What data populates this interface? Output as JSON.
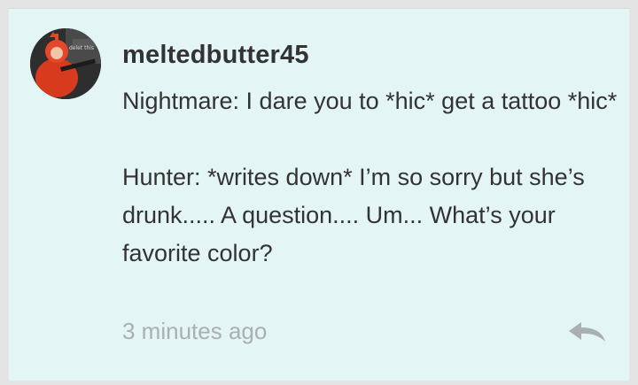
{
  "comment": {
    "username": "meltedbutter45",
    "avatar_caption": "delet this",
    "message_lines": [
      "Nightmare: I dare you to *hic* get a tattoo *hic*",
      "",
      "Hunter: *writes down* I’m so sorry but she’s drunk..... A question.... Um... What’s your favorite color?"
    ],
    "timestamp": "3 minutes ago",
    "reply_icon": "reply-arrow-icon"
  },
  "colors": {
    "card_background": "#e4f5f6",
    "text": "#333333",
    "timestamp": "#a9b0b1",
    "reply_icon": "#a9b0b1"
  }
}
